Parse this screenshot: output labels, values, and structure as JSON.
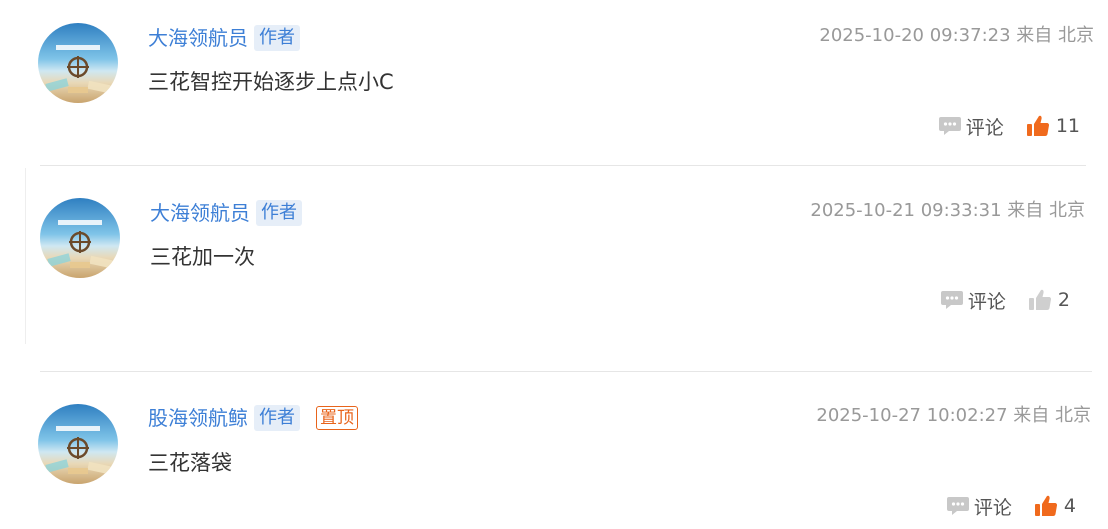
{
  "comments": [
    {
      "username": "大海领航员",
      "author_tag": "作者",
      "pinned_tag": "",
      "meta": "2025-10-20 09:37:23 来自 北京",
      "content": "三花智控开始逐步上点小C",
      "comment_label": "评论",
      "like_count": "11",
      "liked": true
    },
    {
      "username": "大海领航员",
      "author_tag": "作者",
      "pinned_tag": "",
      "meta": "2025-10-21 09:33:31 来自 北京",
      "content": "三花加一次",
      "comment_label": "评论",
      "like_count": "2",
      "liked": false
    },
    {
      "username": "股海领航鲸",
      "author_tag": "作者",
      "pinned_tag": "置顶",
      "meta": "2025-10-27 10:02:27 来自 北京",
      "content": "三花落袋",
      "comment_label": "评论",
      "like_count": "4",
      "liked": true
    }
  ],
  "icons": {
    "comment": "comment-bubble-icon",
    "like": "thumbs-up-icon"
  },
  "colors": {
    "username": "#3d7fd6",
    "author_tag_bg": "#e6eef8",
    "pinned": "#e8641b",
    "like_active": "#f06a1d",
    "like_inactive": "#cfcfcf",
    "meta": "#999999"
  }
}
